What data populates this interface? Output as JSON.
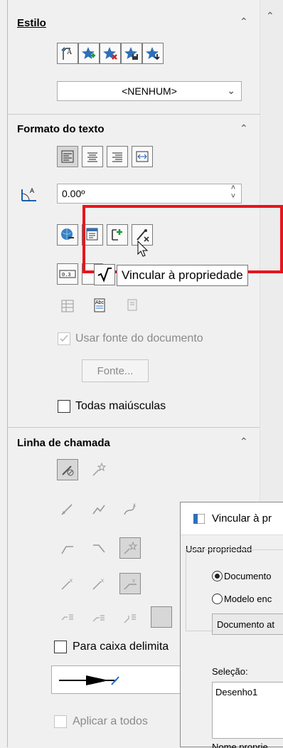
{
  "estilo": {
    "title": "Estilo",
    "dropdown": "<NENHUM>"
  },
  "formato": {
    "title": "Formato do texto",
    "angle": "0.00º",
    "usar_fonte": "Usar fonte do documento",
    "fonte_button": "Fonte...",
    "todas_maiusculas": "Todas maiúsculas"
  },
  "tooltip": {
    "text": "Vincular à propriedade"
  },
  "linha": {
    "title": "Linha de chamada",
    "para_caixa": "Para caixa delimita",
    "aplicar": "Aplicar a todos"
  },
  "dialog": {
    "title": "Vincular à pr",
    "group": "Usar propriedad",
    "opt_documento": "Documento",
    "opt_modelo": "Modelo enc",
    "select_value": "Documento at",
    "selecao_label": "Seleção:",
    "selecao_value": "Desenho1",
    "nome_label": "Nome proprie"
  },
  "colors": {
    "highlight": "#e8141c",
    "link_blue": "#1e6fd0"
  }
}
